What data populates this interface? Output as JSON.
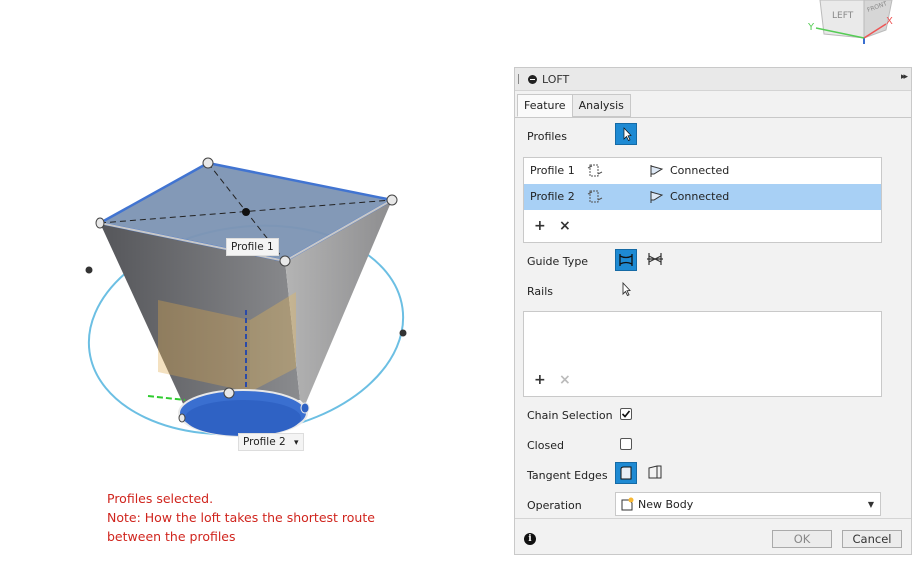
{
  "viewport": {
    "profile1_label": "Profile 1",
    "profile2_label": "Profile 2",
    "profile2_dropdown": "▾"
  },
  "viewcube": {
    "face_left": "LEFT",
    "face_front": "FRONT",
    "axis_x": "X",
    "axis_y": "Y"
  },
  "note": {
    "lines": [
      "Profiles selected.",
      "Note: How the loft takes the shortest route",
      "between the profiles"
    ]
  },
  "panel": {
    "title": "LOFT",
    "expand_glyph": "▸▸",
    "tabs": [
      {
        "label": "Feature"
      },
      {
        "label": "Analysis"
      }
    ],
    "profiles_label": "Profiles",
    "profiles": [
      {
        "name": "Profile 1",
        "status": "Connected"
      },
      {
        "name": "Profile 2",
        "status": "Connected"
      }
    ],
    "add_glyph": "+",
    "remove_glyph": "×",
    "guide_type_label": "Guide Type",
    "rails_label": "Rails",
    "chain_selection_label": "Chain Selection",
    "chain_selection_checked": true,
    "closed_label": "Closed",
    "closed_checked": false,
    "tangent_edges_label": "Tangent Edges",
    "operation_label": "Operation",
    "operation_value": "New Body",
    "info_glyph": "i",
    "ok_label": "OK",
    "cancel_label": "Cancel"
  },
  "colors": {
    "accent": "#1e8ad3",
    "selected_row": "#a8d0f5",
    "note": "#d0251e",
    "loft_blue": "#3a6fd0"
  }
}
